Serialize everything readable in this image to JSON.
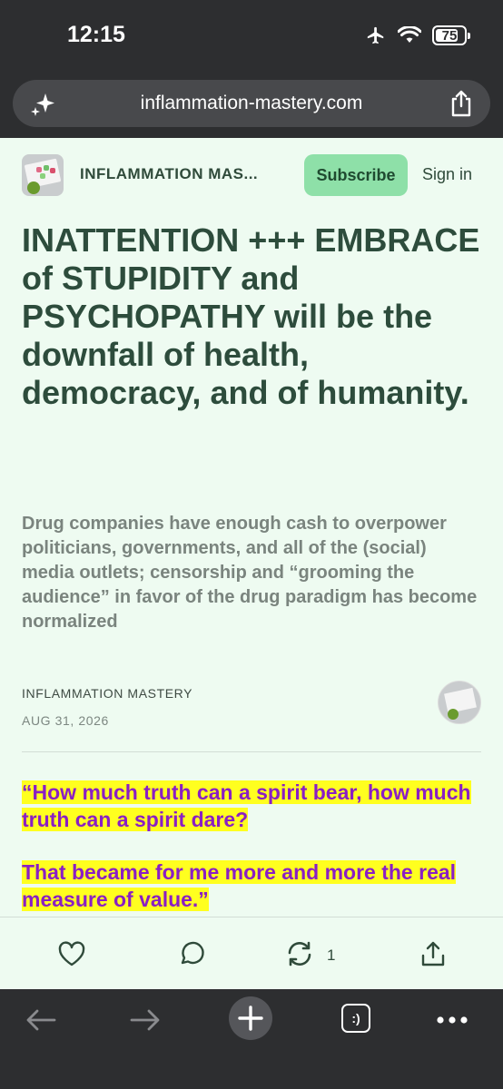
{
  "status_bar": {
    "time": "12:15",
    "battery": "75"
  },
  "url_bar": {
    "url": "inflammation-mastery.com"
  },
  "site": {
    "name": "INFLAMMATION MAS...",
    "subscribe_label": "Subscribe",
    "signin_label": "Sign in"
  },
  "article": {
    "title": "INATTENTION +++ EMBRACE of STUPIDITY and PSYCHOPATHY will be the downfall of health, democracy, and of humanity.",
    "subtitle": "Drug companies have enough cash to overpower politicians, governments, and all of the (social) media outlets; censorship and “grooming the audience” in favor of the drug paradigm has become normalized",
    "author": "INFLAMMATION MASTERY",
    "date": "AUG 31, 2026",
    "quote_1": "“How much truth can a spirit bear, how much truth can a spirit dare?",
    "quote_2": "That became for me more and more the real measure of value.”"
  },
  "actions": {
    "restack_count": "1"
  },
  "toolbar": {
    "tabs_label": ":)"
  },
  "colors": {
    "accent": "#8ee0a8",
    "page_bg": "#eefbf1",
    "headline": "#2d4c3c",
    "highlight": "#ffff1f",
    "quote_text": "#8a1fc4"
  },
  "icons": [
    "sparkle-icon",
    "share-icon",
    "heart-icon",
    "comment-icon",
    "restack-icon",
    "back-icon",
    "forward-icon",
    "plus-icon",
    "tabs-icon",
    "more-icon",
    "airplane-icon",
    "wifi-icon"
  ]
}
